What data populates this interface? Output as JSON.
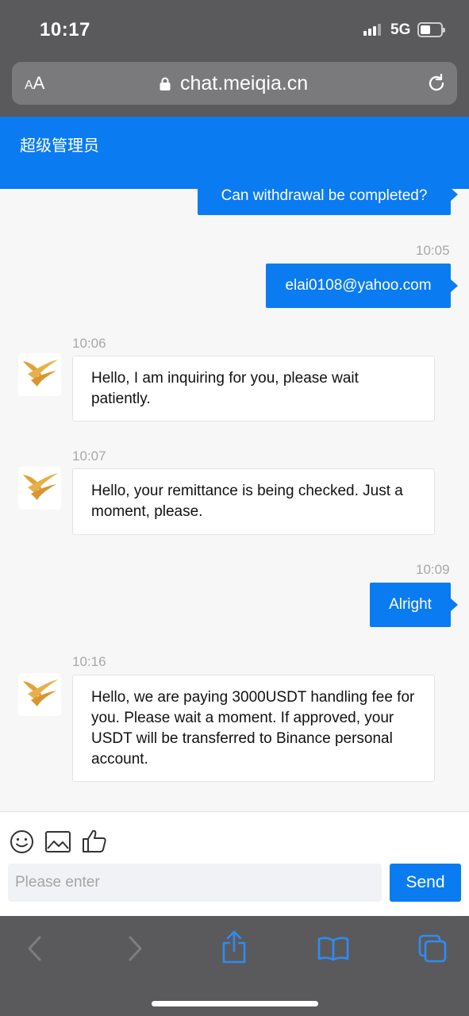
{
  "status_bar": {
    "time": "10:17",
    "network": "5G"
  },
  "browser": {
    "aa_small": "A",
    "aa_large": "A",
    "url": "chat.meiqia.cn"
  },
  "chat": {
    "title": "超级管理员",
    "messages": [
      {
        "dir": "out",
        "text": "Can withdrawal be completed?"
      },
      {
        "dir": "out",
        "time": "10:05",
        "text": "elai0108@yahoo.com"
      },
      {
        "dir": "in",
        "time": "10:06",
        "text": "Hello, I am inquiring for you, please wait patiently."
      },
      {
        "dir": "in",
        "time": "10:07",
        "text": "Hello, your remittance is being checked. Just a moment, please."
      },
      {
        "dir": "out",
        "time": "10:09",
        "text": "Alright"
      },
      {
        "dir": "in",
        "time": "10:16",
        "text": "Hello, we are paying 3000USDT handling fee for you. Please wait a moment. If approved, your USDT will be transferred to Binance personal account."
      }
    ]
  },
  "composer": {
    "placeholder": "Please enter",
    "send_label": "Send"
  },
  "icons": [
    "lock-icon",
    "reload-icon",
    "emoji-icon",
    "image-icon",
    "thumbs-up-icon",
    "back-icon",
    "forward-icon",
    "share-icon",
    "bookmarks-icon",
    "tabs-icon",
    "agent-logo-icon"
  ],
  "colors": {
    "accent": "#0a7bf1",
    "browser_chrome": "#5a5a5c",
    "avatar_gold": "#e0a23a"
  }
}
